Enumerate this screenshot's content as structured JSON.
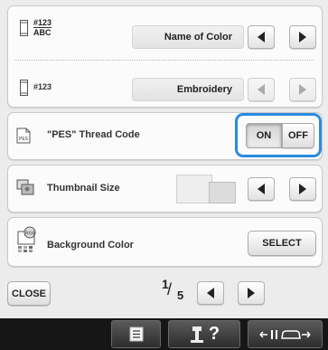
{
  "rows": {
    "thread_number": {
      "icon_text_top": "#123",
      "icon_text_bottom": "ABC",
      "value": "Name of Color"
    },
    "thread_display": {
      "icon_label": "#123",
      "value": "Embroidery"
    },
    "pes_thread_code": {
      "label": "\"PES\" Thread Code",
      "on_label": "ON",
      "off_label": "OFF",
      "selected": "ON",
      "highlight_color": "#2a8be0"
    },
    "thumbnail_size": {
      "label": "Thumbnail Size"
    },
    "background_color": {
      "label": "Background Color",
      "button_label": "SELECT"
    }
  },
  "footer": {
    "close_label": "CLOSE",
    "page_current": "1",
    "page_total": "5"
  },
  "bottom_bar": {
    "help_text": "?",
    "icons": [
      "settings-list-icon",
      "help-icon",
      "needle-bar-icon"
    ]
  }
}
